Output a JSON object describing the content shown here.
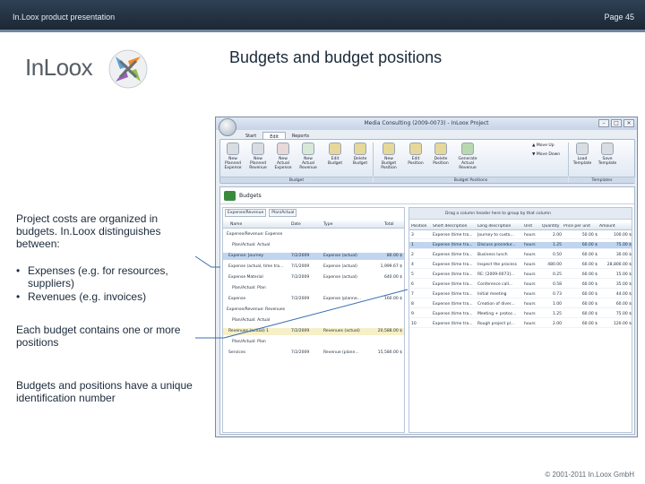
{
  "header": {
    "left": "In.Loox product presentation",
    "right": "Page 45"
  },
  "logo": {
    "word": "InLoox"
  },
  "title": "Budgets and budget positions",
  "left_text": {
    "intro": "Project costs are organized in budgets. In.Loox distinguishes between:",
    "bullets": [
      "Expenses (e.g. for resources, suppliers)",
      "Revenues (e.g. invoices)"
    ],
    "bullet_symbol": "•",
    "para2": "Each budget contains one or more positions",
    "para3": "Budgets and positions have a unique identification number"
  },
  "footer": "© 2001-2011 In.Loox GmbH",
  "app": {
    "window_title": "Media Consulting (2009-0073) - InLoox Project",
    "tabs": [
      "Start",
      "Edit",
      "Reports"
    ],
    "ribbon": [
      {
        "label": "New Planned Expense",
        "color": "#d9dde3"
      },
      {
        "label": "New Planned Revenue",
        "color": "#d9dde3"
      },
      {
        "label": "New Actual Expense",
        "color": "#e8d8d8"
      },
      {
        "label": "New Actual Revenue",
        "color": "#d8e8d8"
      },
      {
        "label": "Edit Budget",
        "color": "#e6d89a"
      },
      {
        "label": "Delete Budget",
        "color": "#e6d89a"
      },
      {
        "label": "New Budget Position",
        "color": "#e6d89a"
      },
      {
        "label": "Edit Position",
        "color": "#e6d89a"
      },
      {
        "label": "Delete Position",
        "color": "#e6d89a"
      },
      {
        "label": "Generate Actual Revenue",
        "color": "#b9d8b0"
      },
      {
        "label": "Load Template",
        "color": "#d9dde3"
      },
      {
        "label": "Save Template",
        "color": "#d9dde3"
      }
    ],
    "ribbon_small": [
      "Move Up",
      "Move Down"
    ],
    "groups": [
      "Budget",
      "Budget Positions",
      "Templates"
    ],
    "section_title": "Budgets",
    "filters": [
      "Expense/Revenue",
      "Plan/Actual"
    ],
    "left_columns": [
      "Name",
      "Date",
      "Type",
      "Total"
    ],
    "left_rows": [
      {
        "kind": "group",
        "text": "Expense/Revenue: Expense"
      },
      {
        "kind": "sub",
        "text": "Plan/Actual: Actual"
      },
      {
        "kind": "row",
        "name": "Expense: Journey",
        "date": "7/2/2009",
        "type": "Expense (actual)",
        "total": "80.00 $",
        "sel": true
      },
      {
        "kind": "row",
        "name": "Expense (actual, time tra...",
        "date": "7/1/2009",
        "type": "Expense (actual)",
        "total": "1,999.67 $"
      },
      {
        "kind": "row",
        "name": "Expense Material",
        "date": "7/2/2009",
        "type": "Expense (actual)",
        "total": "640.00 $"
      },
      {
        "kind": "sub",
        "text": "Plan/Actual: Plan"
      },
      {
        "kind": "row",
        "name": "Expense",
        "date": "7/2/2009",
        "type": "Expense (planne...",
        "total": "160.00 $"
      },
      {
        "kind": "group",
        "text": "Expense/Revenue: Revenues"
      },
      {
        "kind": "sub",
        "text": "Plan/Actual: Actual"
      },
      {
        "kind": "row",
        "name": "Revenues (actual) 1",
        "date": "7/2/2009",
        "type": "Revenues (actual)",
        "total": "20,588.00 $",
        "hl": true
      },
      {
        "kind": "sub",
        "text": "Plan/Actual: Plan"
      },
      {
        "kind": "row",
        "name": "Services",
        "date": "7/2/2009",
        "type": "Revenue (plann...",
        "total": "15,580.00 $"
      }
    ],
    "drag_hint": "Drag a column header here to group by that column",
    "right_columns": [
      "Position",
      "Short description",
      "Long description",
      "Unit",
      "Quantity",
      "Price per unit",
      "Amount"
    ],
    "right_rows": [
      [
        "3",
        "Expense (time tra...",
        "Journey to custo...",
        "hours",
        "2.00",
        "50.00 $",
        "100.00 $"
      ],
      [
        "1",
        "Expense (time tra...",
        "Discuss procedur...",
        "hours",
        "1.25",
        "60.00 $",
        "75.00 $"
      ],
      [
        "2",
        "Expense (time tra...",
        "Business lunch",
        "hours",
        "0.50",
        "60.00 $",
        "30.00 $"
      ],
      [
        "4",
        "Expense (time tra...",
        "Inspect the process",
        "hours",
        "480.00",
        "60.00 $",
        "28,800.00 $"
      ],
      [
        "5",
        "Expense (time tra...",
        "RE: [2009-0073]...",
        "hours",
        "0.25",
        "60.00 $",
        "15.00 $"
      ],
      [
        "6",
        "Expense (time tra...",
        "Conference call...",
        "hours",
        "0.58",
        "60.00 $",
        "35.00 $"
      ],
      [
        "7",
        "Expense (time tra...",
        "Initial meeting",
        "hours",
        "0.73",
        "60.00 $",
        "44.00 $"
      ],
      [
        "8",
        "Expense (time tra...",
        "Creation of diver...",
        "hours",
        "1.00",
        "60.00 $",
        "60.00 $"
      ],
      [
        "9",
        "Expense (time tra...",
        "Meeting + protoc...",
        "hours",
        "1.25",
        "60.00 $",
        "75.00 $"
      ],
      [
        "10",
        "Expense (time tra...",
        "Rough project pl...",
        "hours",
        "2.00",
        "60.00 $",
        "120.00 $"
      ]
    ]
  }
}
